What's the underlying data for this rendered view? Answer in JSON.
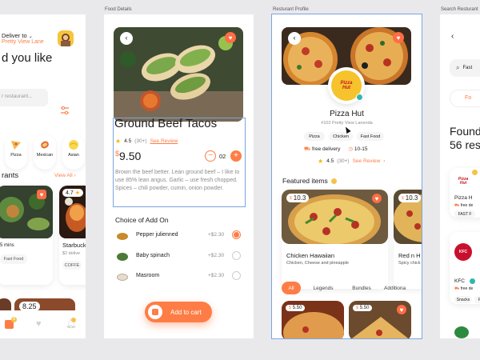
{
  "colors": {
    "accent": "#fe7d46",
    "heart": "#fe6d44",
    "background": "#e9e9ec"
  },
  "labels": {
    "food_details": "Food Details",
    "restaurant_profile": "Resturant Profile",
    "search_restaurant": "Search Resturant"
  },
  "home": {
    "deliver_to": "Deliver to",
    "address": "Pretty View Lane",
    "headline": "d you like",
    "search_placeholder": "r restaurant...",
    "categories": [
      "Pizza",
      "Mexican",
      "Asian"
    ],
    "section_title": "rants",
    "view_all": "View All",
    "card1": {
      "mins": "5 mins",
      "tag": "Fast Food"
    },
    "card2": {
      "rating": "4.7",
      "name": "Starbuck",
      "delivery": "$2 delive",
      "tag": "COFFE"
    },
    "price_partial": "8.25",
    "nav_badge": "8"
  },
  "details": {
    "title": "Ground Beef  Tacos",
    "rating": "4.5",
    "reviews": "(30+)",
    "see_review": "See Review",
    "price_symbol": "$",
    "price": "9.50",
    "quantity": "02",
    "description": "Brown the beef better. Lean ground beef – I like to use 85% lean angus. Garlic – use fresh chopped. Spices – chili powder, cumin, onion powder.",
    "addon_title": "Choice of Add On",
    "addons": [
      {
        "name": "Pepper  julienned",
        "price": "+$2.30",
        "selected": true
      },
      {
        "name": "Baby spinach",
        "price": "+$2.30",
        "selected": false
      },
      {
        "name": "Masroom",
        "price": "+$2.30",
        "selected": false
      }
    ],
    "add_to_cart": "Add to cart"
  },
  "restaurant": {
    "name": "Pizza Hut",
    "logo_text": "Pizza Hut",
    "address": "#102  Pretty View Lanenda",
    "tags": [
      "Pizza",
      "Chicken",
      "Fast Food"
    ],
    "delivery": "free delivery",
    "time": "10-15",
    "rating": "4.5",
    "reviews": "(30+)",
    "see_review": "See Review",
    "featured_title": "Featured items",
    "items": [
      {
        "price": "10.3",
        "name": "Chicken Hawaiian",
        "desc": "Chicken, Cheese and pineapple"
      },
      {
        "price": "10.3",
        "name": "Red n H",
        "desc": "Spicy chick"
      }
    ],
    "tabs": [
      "All",
      "Legends",
      "Bundles",
      "Additiona"
    ],
    "bottom_prices": [
      "5.50",
      "5.50"
    ]
  },
  "search": {
    "search_value": "Fast",
    "chip_partial": "Fo",
    "found_line1": "Found",
    "found_line2": "56 res",
    "results": [
      {
        "name": "Pizza H",
        "logo": "Pizza Hut",
        "delivery": "free de",
        "tags": [
          "FAST F"
        ]
      },
      {
        "name": "KFC",
        "logo": "KFC",
        "delivery": "free de",
        "tags": [
          "Snacks",
          "FA"
        ]
      }
    ]
  }
}
